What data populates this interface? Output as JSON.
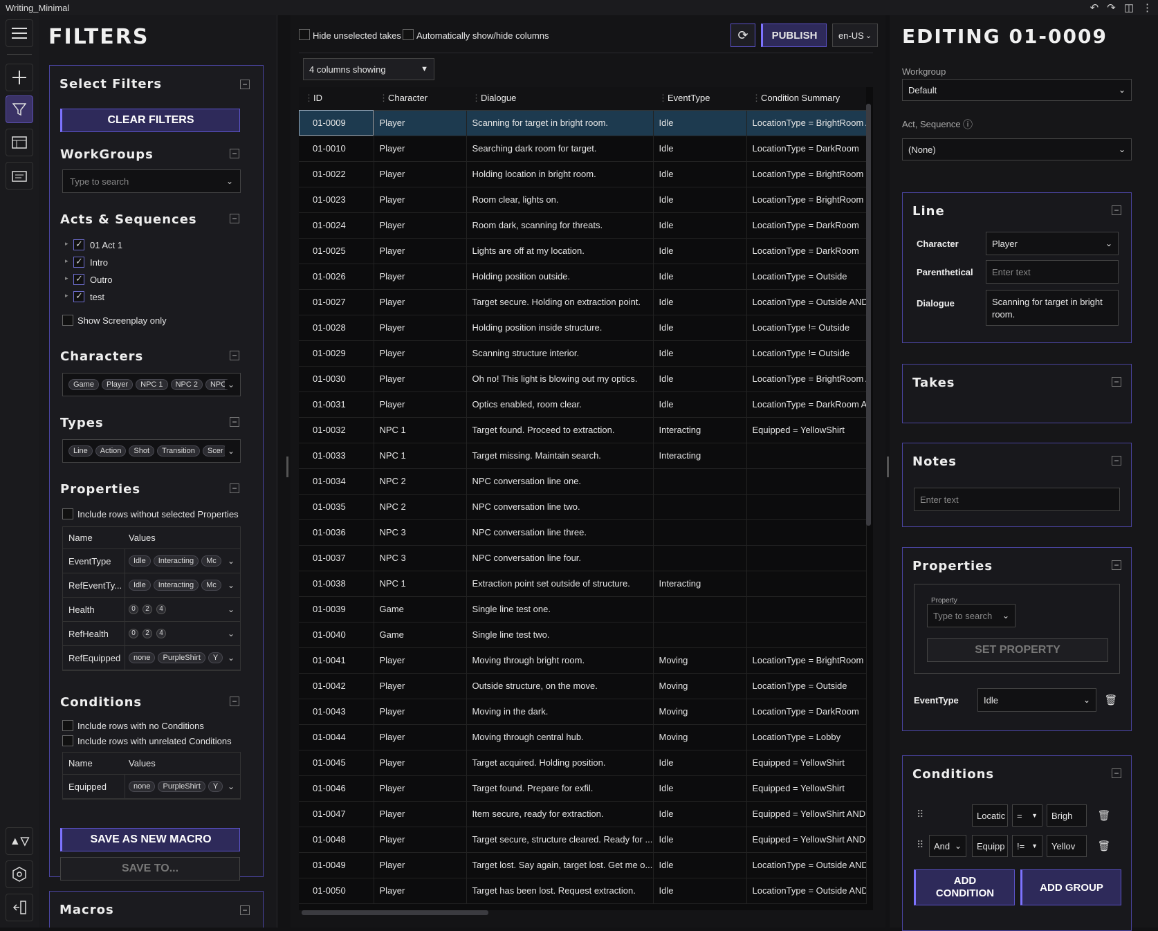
{
  "window": {
    "title": "Writing_Minimal"
  },
  "filters": {
    "title": "FILTERS",
    "select_filters": "Select Filters",
    "clear_filters": "CLEAR FILTERS",
    "workgroups": {
      "title": "WorkGroups",
      "placeholder": "Type to search"
    },
    "acts": {
      "title": "Acts & Sequences",
      "items": [
        "01 Act 1",
        "Intro",
        "Outro",
        "test"
      ],
      "show_screenplay": "Show Screenplay only"
    },
    "characters": {
      "title": "Characters",
      "chips": [
        "Game",
        "Player",
        "NPC 1",
        "NPC 2",
        "NPC"
      ]
    },
    "types": {
      "title": "Types",
      "chips": [
        "Line",
        "Action",
        "Shot",
        "Transition",
        "Scer"
      ]
    },
    "properties": {
      "title": "Properties",
      "include_without": "Include rows without selected Properties",
      "col_name": "Name",
      "col_values": "Values",
      "rows": [
        {
          "name": "EventType",
          "chips": [
            "Idle",
            "Interacting",
            "Mc"
          ]
        },
        {
          "name": "RefEventTy...",
          "chips": [
            "Idle",
            "Interacting",
            "Mc"
          ]
        },
        {
          "name": "Health",
          "nums": [
            "0",
            "2",
            "4"
          ]
        },
        {
          "name": "RefHealth",
          "nums": [
            "0",
            "2",
            "4"
          ]
        },
        {
          "name": "RefEquipped",
          "chips": [
            "none",
            "PurpleShirt",
            "Y"
          ]
        }
      ]
    },
    "conditions": {
      "title": "Conditions",
      "include_no": "Include rows with no Conditions",
      "include_unrelated": "Include rows with unrelated Conditions",
      "col_name": "Name",
      "col_values": "Values",
      "rows": [
        {
          "name": "Equipped",
          "chips": [
            "none",
            "PurpleShirt",
            "Y"
          ]
        }
      ]
    },
    "save_macro": "SAVE AS NEW MACRO",
    "save_to": "SAVE TO...",
    "macros": "Macros"
  },
  "main": {
    "hide_unselected": "Hide unselected takes",
    "auto_columns": "Automatically show/hide columns",
    "publish": "PUBLISH",
    "locale": "en-US",
    "columns_showing": "4 columns showing",
    "headers": [
      "ID",
      "Character",
      "Dialogue",
      "EventType",
      "Condition Summary"
    ],
    "rows": [
      [
        "01-0009",
        "Player",
        "Scanning for target in bright room.",
        "Idle",
        "LocationType = BrightRoom A"
      ],
      [
        "01-0010",
        "Player",
        "Searching dark room for target.",
        "Idle",
        "LocationType = DarkRoom"
      ],
      [
        "01-0022",
        "Player",
        "Holding location in bright room.",
        "Idle",
        "LocationType = BrightRoom"
      ],
      [
        "01-0023",
        "Player",
        "Room clear, lights on.",
        "Idle",
        "LocationType = BrightRoom"
      ],
      [
        "01-0024",
        "Player",
        "Room dark, scanning for threats.",
        "Idle",
        "LocationType = DarkRoom"
      ],
      [
        "01-0025",
        "Player",
        "Lights are off at my location.",
        "Idle",
        "LocationType = DarkRoom"
      ],
      [
        "01-0026",
        "Player",
        "Holding position outside.",
        "Idle",
        "LocationType = Outside"
      ],
      [
        "01-0027",
        "Player",
        "Target secure. Holding on extraction point.",
        "Idle",
        "LocationType = Outside AND"
      ],
      [
        "01-0028",
        "Player",
        "Holding position inside structure.",
        "Idle",
        "LocationType != Outside"
      ],
      [
        "01-0029",
        "Player",
        "Scanning structure interior.",
        "Idle",
        "LocationType != Outside"
      ],
      [
        "01-0030",
        "Player",
        "Oh no! This light is blowing out my optics.",
        "Idle",
        "LocationType = BrightRoom A"
      ],
      [
        "01-0031",
        "Player",
        "Optics enabled, room clear.",
        "Idle",
        "LocationType = DarkRoom AN"
      ],
      [
        "01-0032",
        "NPC 1",
        "Target found. Proceed to extraction.",
        "Interacting",
        "Equipped = YellowShirt"
      ],
      [
        "01-0033",
        "NPC 1",
        "Target missing. Maintain search.",
        "Interacting",
        ""
      ],
      [
        "01-0034",
        "NPC 2",
        "NPC conversation line one.",
        "",
        ""
      ],
      [
        "01-0035",
        "NPC 2",
        "NPC conversation line two.",
        "",
        ""
      ],
      [
        "01-0036",
        "NPC 3",
        "NPC conversation line three.",
        "",
        ""
      ],
      [
        "01-0037",
        "NPC 3",
        "NPC conversation line four.",
        "",
        ""
      ],
      [
        "01-0038",
        "NPC 1",
        "Extraction point set outside of structure.",
        "Interacting",
        ""
      ],
      [
        "01-0039",
        "Game",
        "Single line test one.",
        "",
        ""
      ],
      [
        "01-0040",
        "Game",
        "Single line test two.",
        "",
        ""
      ],
      [
        "01-0041",
        "Player",
        "Moving through bright room.",
        "Moving",
        "LocationType = BrightRoom"
      ],
      [
        "01-0042",
        "Player",
        "Outside structure, on the move.",
        "Moving",
        "LocationType = Outside"
      ],
      [
        "01-0043",
        "Player",
        "Moving in the dark.",
        "Moving",
        "LocationType = DarkRoom"
      ],
      [
        "01-0044",
        "Player",
        "Moving through central hub.",
        "Moving",
        "LocationType = Lobby"
      ],
      [
        "01-0045",
        "Player",
        "Target acquired. Holding position.",
        "Idle",
        "Equipped = YellowShirt"
      ],
      [
        "01-0046",
        "Player",
        "Target found. Prepare for exfil.",
        "Idle",
        "Equipped = YellowShirt"
      ],
      [
        "01-0047",
        "Player",
        "Item secure, ready for extraction.",
        "Idle",
        "Equipped = YellowShirt AND I"
      ],
      [
        "01-0048",
        "Player",
        "Target secure, structure cleared. Ready for ...",
        "Idle",
        "Equipped = YellowShirt AND I"
      ],
      [
        "01-0049",
        "Player",
        "Target lost. Say again, target lost. Get me o...",
        "Idle",
        "LocationType = Outside AND"
      ],
      [
        "01-0050",
        "Player",
        "Target has been lost. Request extraction.",
        "Idle",
        "LocationType = Outside AND"
      ]
    ]
  },
  "editor": {
    "title": "EDITING 01-0009",
    "workgroup_label": "Workgroup",
    "workgroup_value": "Default",
    "act_label": "Act, Sequence",
    "act_value": "(None)",
    "line": {
      "title": "Line",
      "character_label": "Character",
      "character_value": "Player",
      "parenthetical_label": "Parenthetical",
      "parenthetical_placeholder": "Enter text",
      "dialogue_label": "Dialogue",
      "dialogue_value": "Scanning for target in bright room."
    },
    "takes": {
      "title": "Takes"
    },
    "notes": {
      "title": "Notes",
      "placeholder": "Enter text"
    },
    "properties": {
      "title": "Properties",
      "property_label": "Property",
      "property_placeholder": "Type to search",
      "set_property": "SET PROPERTY",
      "event_label": "EventType",
      "event_value": "Idle"
    },
    "conditions": {
      "title": "Conditions",
      "row1": {
        "field": "Locatic",
        "op": "=",
        "value": "Brigh"
      },
      "row2": {
        "join": "And",
        "field": "Equipp",
        "op": "!=",
        "value": "Yellov"
      },
      "add_condition": "ADD CONDITION",
      "add_group": "ADD GROUP"
    }
  }
}
